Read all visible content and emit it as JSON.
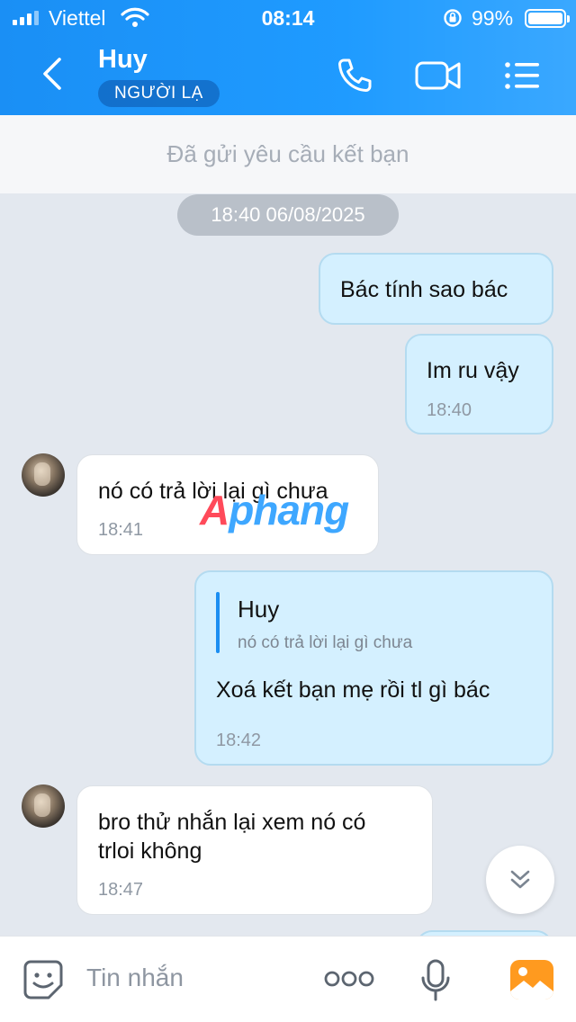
{
  "status_bar": {
    "carrier": "Viettel",
    "time": "08:14",
    "battery": "99%"
  },
  "header": {
    "contact_name": "Huy",
    "badge": "NGƯỜI LẠ"
  },
  "banner": {
    "text": "Đã gửi yêu cầu kết bạn"
  },
  "date_separator": "18:40 06/08/2025",
  "messages": [
    {
      "direction": "out",
      "text": "Bác tính sao bác"
    },
    {
      "direction": "out",
      "text": "Im ru vậy",
      "time": "18:40"
    },
    {
      "direction": "in",
      "text": "nó có trả lời lại gì chưa",
      "time": "18:41"
    },
    {
      "direction": "out",
      "quote": {
        "author": "Huy",
        "text": "nó có trả lời lại gì chưa"
      },
      "text": "Xoá kết bạn mẹ rồi tl gì bác",
      "time": "18:42"
    },
    {
      "direction": "in",
      "text_line1": "bro thử nhắn lại xem nó có",
      "text_line2": "trloi không",
      "time": "18:47"
    }
  ],
  "watermark": {
    "part1": "A",
    "part2": "phang"
  },
  "composer": {
    "placeholder": "Tin nhắn"
  },
  "colors": {
    "header_blue": "#1f9bff",
    "outgoing_bubble": "#d4f0ff",
    "background": "#e3e8ef"
  },
  "icons": [
    "back-icon",
    "phone-icon",
    "video-call-icon",
    "menu-icon",
    "sticker-icon",
    "more-icon",
    "microphone-icon",
    "image-icon",
    "scroll-down-icon"
  ]
}
